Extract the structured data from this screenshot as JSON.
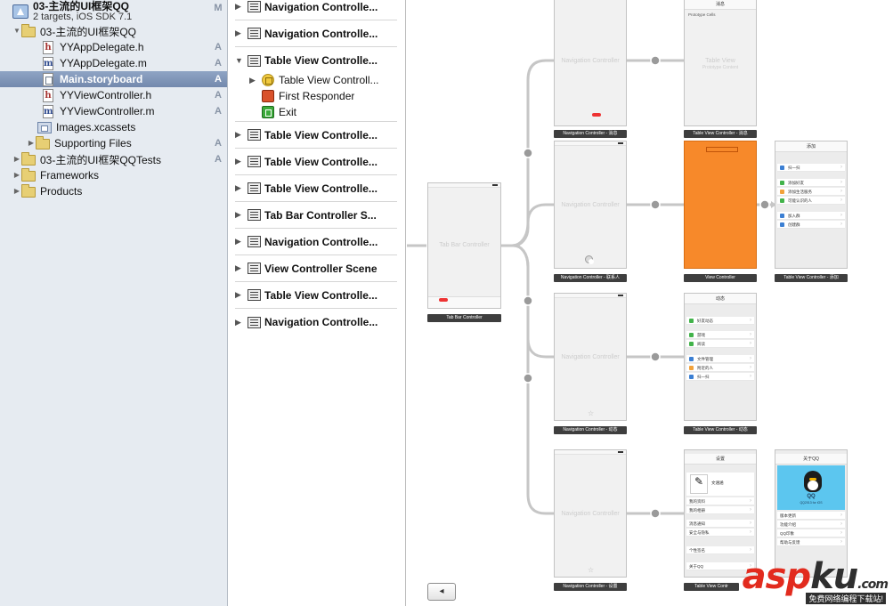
{
  "navigator": {
    "project": {
      "name": "03-主流的UI框架QQ",
      "subtitle": "2 targets, iOS SDK 7.1",
      "status": "M"
    },
    "items": [
      {
        "label": "03-主流的UI框架QQ",
        "status": "",
        "kind": "folder"
      },
      {
        "label": "YYAppDelegate.h",
        "status": "A",
        "kind": "h"
      },
      {
        "label": "YYAppDelegate.m",
        "status": "A",
        "kind": "m"
      },
      {
        "label": "Main.storyboard",
        "status": "A",
        "kind": "storyboard"
      },
      {
        "label": "YYViewController.h",
        "status": "A",
        "kind": "h"
      },
      {
        "label": "YYViewController.m",
        "status": "A",
        "kind": "m"
      },
      {
        "label": "Images.xcassets",
        "status": "",
        "kind": "assets"
      },
      {
        "label": "Supporting Files",
        "status": "A",
        "kind": "folder"
      },
      {
        "label": "03-主流的UI框架QQTests",
        "status": "A",
        "kind": "folder"
      },
      {
        "label": "Frameworks",
        "status": "",
        "kind": "folder"
      },
      {
        "label": "Products",
        "status": "",
        "kind": "folder"
      }
    ],
    "file_letters": {
      "h": "h",
      "m": "m"
    }
  },
  "outline": {
    "scenes": [
      "Navigation Controlle...",
      "Navigation Controlle...",
      "Table View Controlle...",
      "Table View Controlle...",
      "Table View Controlle...",
      "Table View Controlle...",
      "Tab Bar Controller S...",
      "Navigation Controlle...",
      "View Controller Scene",
      "Table View Controlle...",
      "Navigation Controlle..."
    ],
    "children": [
      "Table View Controll...",
      "First Responder",
      "Exit"
    ]
  },
  "canvas": {
    "tab_bar_controller": {
      "title": "Tab Bar Controller",
      "caption": "Tab Bar Controller"
    },
    "nav_title": "Navigation Controller",
    "captions": {
      "nav1": "Navigation Controller - 消息",
      "nav2": "Navigation Controller - 联系人",
      "nav3": "Navigation Controller - 动态",
      "nav4": "Navigation Controller - 设置",
      "tv1": "Table View Controller - 消息",
      "vc": "View Controller",
      "tv_add": "Table View Controller - 添加",
      "tv3": "Table View Controller - 动态",
      "tv4": "Table View Contr"
    },
    "tv1": {
      "navtitle": "消息",
      "header": "Prototype Cells",
      "center": "Table View",
      "center_sub": "Prototype Content"
    },
    "add": {
      "navtitle": "添加",
      "rows": [
        "扫一扫",
        "添加好友",
        "添加生活服务",
        "可能认识的人",
        "加入群",
        "创建群"
      ]
    },
    "dyn": {
      "navtitle": "动态",
      "rows": [
        "好友动态",
        "游戏",
        "阅读",
        "文件管理",
        "附近的人",
        "扫一扫"
      ]
    },
    "settings": {
      "navtitle": "设置",
      "user": "文涵涵",
      "rows": [
        "我的资料",
        "我的相册",
        "消息通知",
        "安全与隐私",
        "个性签名",
        "关于QQ"
      ]
    },
    "about": {
      "navtitle": "关于QQ",
      "app": "QQ",
      "version": "QQ2013 for iOS",
      "rows": [
        "版本更新",
        "功能介绍",
        "QQ印象",
        "帮助与反馈"
      ]
    },
    "bottom_button": "◂"
  },
  "watermark": {
    "part1": "asp",
    "part2": "ku",
    "suffix": ".com",
    "sub": "免费网络编程下载站!"
  },
  "colors": {
    "selected": "#7d92b6",
    "orange": "#f7892a",
    "qq_blue": "#5cc6ef",
    "caption_bg": "#3e3e3e"
  }
}
